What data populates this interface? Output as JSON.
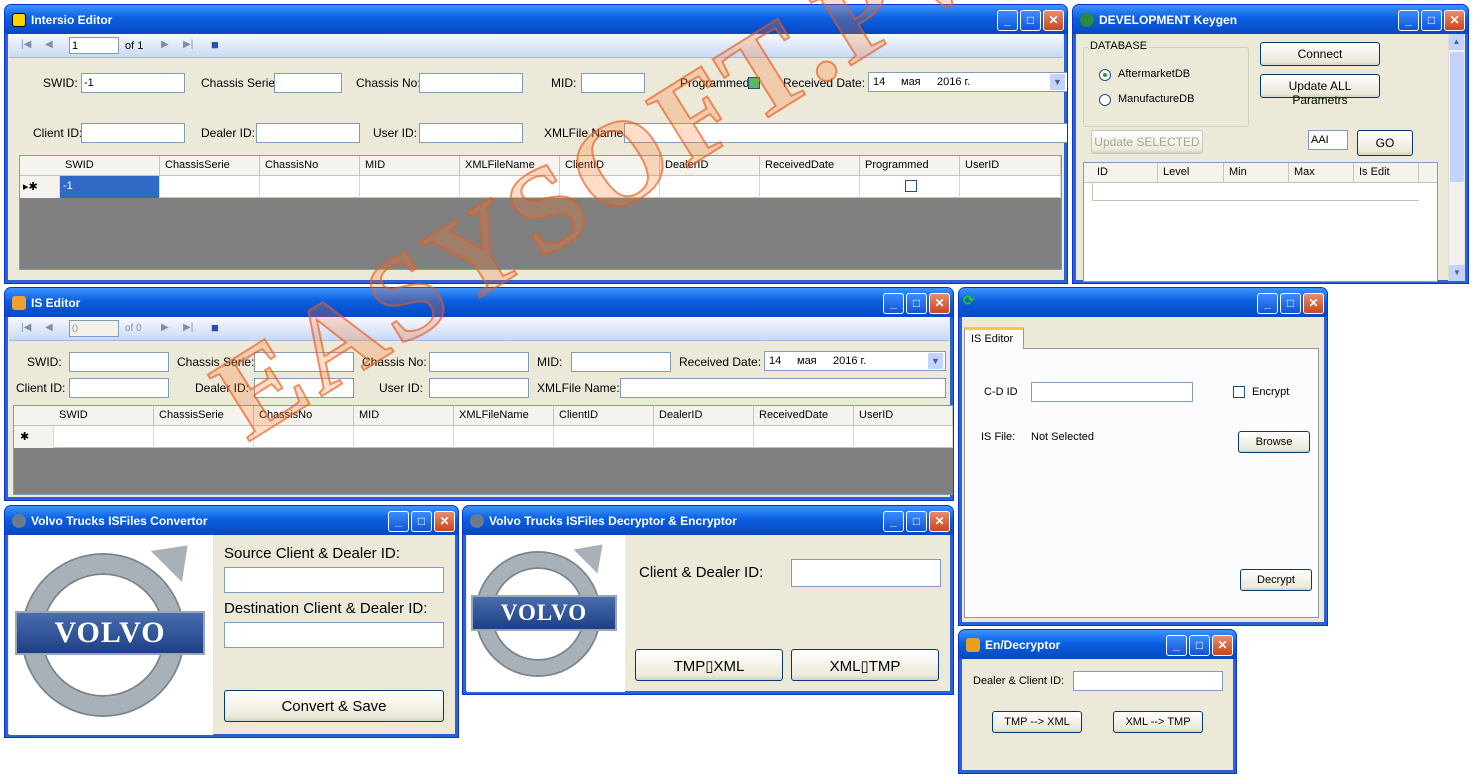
{
  "w1": {
    "title": "Intersio Editor",
    "nav_pos": "1",
    "nav_of": "of 1",
    "labels": {
      "swid": "SWID:",
      "chassis_serie": "Chassis Serie:",
      "chassis_no": "Chassis No:",
      "mid": "MID:",
      "programmed": "Programmed:",
      "received_date": "Received Date:",
      "client_id": "Client ID:",
      "dealer_id": "Dealer ID:",
      "user_id": "User ID:",
      "xmlfile": "XMLFile Name:"
    },
    "swid_value": "-1",
    "date": {
      "day": "14",
      "month": "мая",
      "year": "2016 г."
    },
    "columns": [
      "SWID",
      "ChassisSerie",
      "ChassisNo",
      "MID",
      "XMLFileName",
      "ClientID",
      "DealerID",
      "ReceivedDate",
      "Programmed",
      "UserID"
    ],
    "row": {
      "marker": "▸✱",
      "swid": "-1"
    }
  },
  "w2": {
    "title": "DEVELOPMENT Keygen",
    "group": "DATABASE",
    "radio1": "AftermarketDB",
    "radio2": "ManufactureDB",
    "connect": "Connect",
    "update_all": "Update ALL Parametrs",
    "update_selected": "Update SELECTED",
    "code": "AAI",
    "go": "GO",
    "columns": [
      "ID",
      "Level",
      "Min",
      "Max",
      "Is Edit"
    ]
  },
  "w3": {
    "title": "IS Editor",
    "nav_pos": "0",
    "nav_of": "of 0",
    "labels": {
      "swid": "SWID:",
      "chassis_serie": "Chassis Serie:",
      "chassis_no": "Chassis No:",
      "mid": "MID:",
      "received_date": "Received Date:",
      "client_id": "Client ID:",
      "dealer_id": "Dealer ID:",
      "user_id": "User ID:",
      "xmlfile": "XMLFile Name:"
    },
    "date": {
      "day": "14",
      "month": "мая",
      "year": "2016 г."
    },
    "columns": [
      "SWID",
      "ChassisSerie",
      "ChassisNo",
      "MID",
      "XMLFileName",
      "ClientID",
      "DealerID",
      "ReceivedDate",
      "UserID"
    ],
    "row_marker": "✱"
  },
  "w4": {
    "tab": "IS Editor",
    "cd_label": "C-D ID",
    "encrypt": "Encrypt",
    "is_file_label": "IS File:",
    "is_file_value": "Not Selected",
    "browse": "Browse",
    "decrypt": "Decrypt"
  },
  "w5": {
    "title": "Volvo Trucks ISFiles Convertor",
    "source_label": "Source Client & Dealer ID:",
    "dest_label": "Destination Client & Dealer ID:",
    "convert": "Convert & Save",
    "logo": "VOLVO"
  },
  "w6": {
    "title": "Volvo Trucks ISFiles Decryptor & Encryptor",
    "label": "Client & Dealer ID:",
    "btn1": "TMP▯XML",
    "btn2": "XML▯TMP",
    "logo": "VOLVO"
  },
  "w7": {
    "title": "En/Decryptor",
    "label": "Dealer & Client ID:",
    "btn1": "TMP --> XML",
    "btn2": "XML --> TMP"
  },
  "watermark": "EASYSOFT.PW"
}
